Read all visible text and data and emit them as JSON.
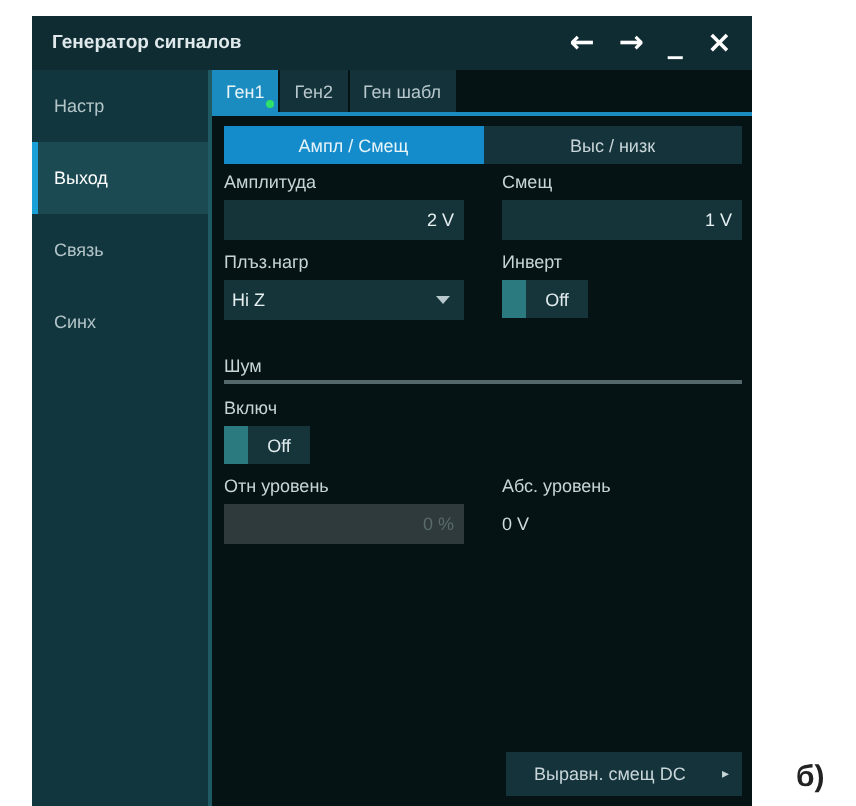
{
  "window": {
    "title": "Генератор сигналов",
    "controls": [
      "←",
      "→",
      "_",
      "×"
    ]
  },
  "sidebar": {
    "items": [
      {
        "label": "Настр",
        "selected": false
      },
      {
        "label": "Выход",
        "selected": true
      },
      {
        "label": "Связь",
        "selected": false
      },
      {
        "label": "Синх",
        "selected": false
      }
    ]
  },
  "tabs": [
    {
      "label": "Ген1",
      "selected": true,
      "running": true
    },
    {
      "label": "Ген2",
      "selected": false,
      "running": false
    },
    {
      "label": "Ген шабл",
      "selected": false,
      "running": false
    }
  ],
  "mode": [
    {
      "label": "Ампл / Смещ",
      "selected": true
    },
    {
      "label": "Выс / низк",
      "selected": false
    }
  ],
  "amplitude": {
    "label": "Амплитуда",
    "value": "2 V"
  },
  "offset": {
    "label": "Смещ",
    "value": "1 V"
  },
  "load": {
    "label": "Плъз.нагр",
    "value": "Hi Z"
  },
  "invert": {
    "label": "Инверт",
    "text": "Off",
    "on": false
  },
  "noise": {
    "heading": "Шум",
    "enable": {
      "label": "Включ",
      "text": "Off",
      "on": false
    },
    "relative": {
      "label": "Отн уровень",
      "value": "0 %",
      "disabled": true
    },
    "absolute": {
      "label": "Абс. уровень",
      "value": "0 V"
    }
  },
  "dc_button": {
    "label": "Выравн. смещ DC",
    "arrow": "▸"
  },
  "caption": "б)"
}
